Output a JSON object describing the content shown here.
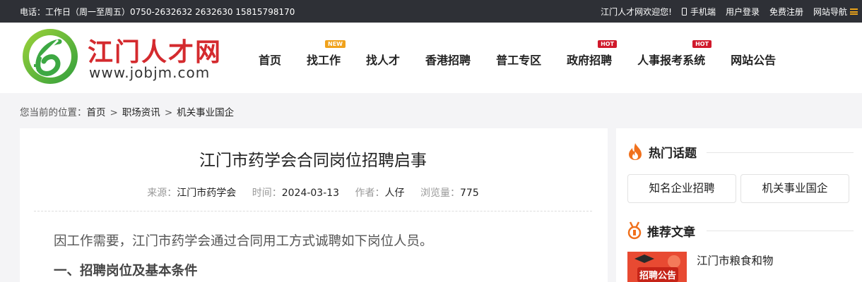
{
  "topbar": {
    "phone": "电话：工作日（周一至周五）0750-2632632 2632630 15815798170",
    "welcome": "江门人才网欢迎您!",
    "mobile": "手机端",
    "login": "用户登录",
    "register": "免费注册",
    "sitenav": "网站导航"
  },
  "logo": {
    "title": "江门人才网",
    "url": "www.jobjm.com"
  },
  "nav": [
    {
      "label": "首页",
      "badge": ""
    },
    {
      "label": "找工作",
      "badge": "NEW"
    },
    {
      "label": "找人才",
      "badge": ""
    },
    {
      "label": "香港招聘",
      "badge": ""
    },
    {
      "label": "普工专区",
      "badge": ""
    },
    {
      "label": "政府招聘",
      "badge": "HOT"
    },
    {
      "label": "人事报考系统",
      "badge": "HOT"
    },
    {
      "label": "网站公告",
      "badge": ""
    }
  ],
  "breadcrumb": {
    "prefix": "您当前的位置：",
    "items": [
      "首页",
      "职场资讯",
      "机关事业国企"
    ],
    "sep": ">"
  },
  "article": {
    "title": "江门市药学会合同岗位招聘启事",
    "meta": {
      "source_label": "来源：",
      "source": "江门市药学会",
      "time_label": "时间：",
      "time": "2024-03-13",
      "author_label": "作者：",
      "author": "人仔",
      "views_label": "浏览量：",
      "views": "775"
    },
    "paragraph": "因工作需要，江门市药学会通过合同用工方式诚聘如下岗位人员。",
    "heading": "一、招聘岗位及基本条件"
  },
  "sidebar": {
    "hot_title": "热门话题",
    "topics": [
      "知名企业招聘",
      "机关事业国企"
    ],
    "rec_title": "推荐文章",
    "rec_thumb_label": "招聘公告",
    "rec_article": "江门市粮食和物"
  },
  "colors": {
    "topbar_bg": "#2e3036",
    "brand_red": "#d42a2e",
    "brand_green": "#3da843",
    "hot": "#d0192b",
    "new": "#f0a21c",
    "accent_orange": "#f0701c"
  }
}
